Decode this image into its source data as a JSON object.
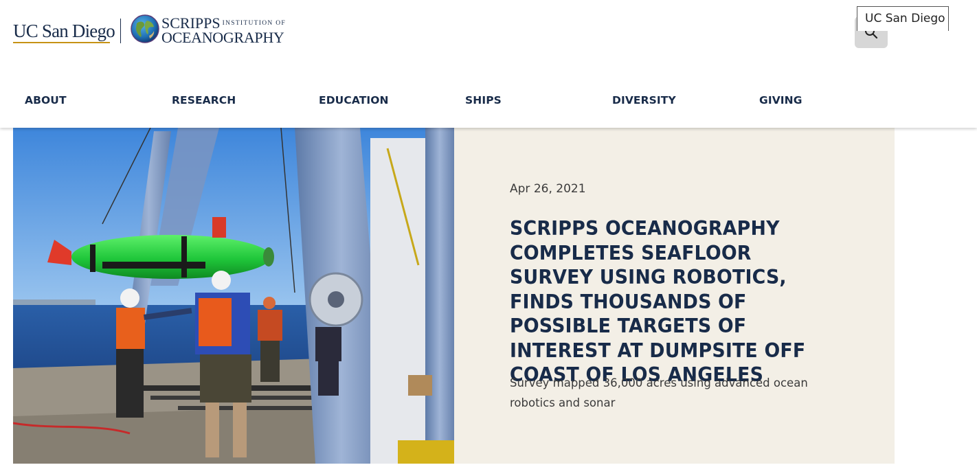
{
  "header": {
    "logo_ucsd": "UC San Diego",
    "logo_sio_line1": "SCRIPPS",
    "logo_sio_line1_small": "INSTITUTION OF",
    "logo_sio_line2": "OCEANOGRAPHY",
    "search_icon": "search-icon",
    "ucsd_tag": "UC San Diego"
  },
  "nav": {
    "items": [
      {
        "label": "ABOUT"
      },
      {
        "label": "RESEARCH"
      },
      {
        "label": "EDUCATION"
      },
      {
        "label": "SHIPS"
      },
      {
        "label": "DIVERSITY"
      },
      {
        "label": "GIVING"
      }
    ]
  },
  "feature": {
    "date": "Apr 26, 2021",
    "headline": "Scripps Oceanography Completes Seafloor Survey Using Robotics, Finds Thousands of Possible Targets of Interest at Dumpsite off Coast of Los Angeles",
    "subtitle": "Survey mapped 36,000 acres using advanced ocean robotics and sonar"
  },
  "colors": {
    "brand_navy": "#182b49",
    "brand_gold": "#c69214",
    "panel_bg": "#f3efe6",
    "auv_green": "#1fc63a"
  }
}
